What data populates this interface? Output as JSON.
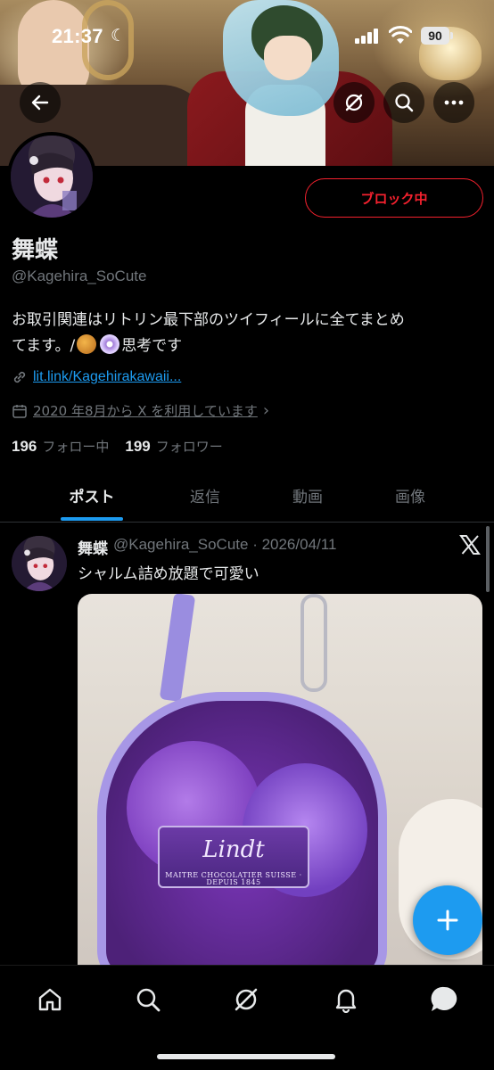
{
  "status_bar": {
    "time": "21:37",
    "battery": "90"
  },
  "header": {
    "back_icon": "arrow-left-icon",
    "grok_icon": "grok-icon",
    "search_icon": "search-icon",
    "more_icon": "more-icon"
  },
  "profile": {
    "display_name": "舞蝶",
    "handle": "@Kagehira_SoCute",
    "block_button_label": "ブロック中",
    "bio_line1": "お取引関連はリトリン最下部のツイフィールに全てまとめ",
    "bio_line2_pre": "てます。/",
    "bio_line2_post": "思考です",
    "link": "lit.link/Kagehirakawaii...",
    "joined": "2020 年8月から X を利用しています",
    "following_count": "196",
    "following_label": "フォロー中",
    "followers_count": "199",
    "followers_label": "フォロワー"
  },
  "tabs": [
    {
      "label": "ポスト",
      "active": true
    },
    {
      "label": "返信",
      "active": false
    },
    {
      "label": "動画",
      "active": false
    },
    {
      "label": "画像",
      "active": false
    }
  ],
  "post": {
    "name": "舞蝶",
    "meta": "@Kagehira_SoCute · 2026/04/11",
    "text": "シャルム詰め放題で可愛い",
    "image_label_brand": "Lindt",
    "image_label_sub": "MAITRE CHOCOLATIER SUISSE · DEPUIS 1845"
  },
  "colors": {
    "accent": "#1d9bf0",
    "block_red": "#f4212e",
    "muted": "#71767b",
    "text": "#e7e9ea"
  },
  "bottom_nav": [
    "home-icon",
    "search-icon",
    "grok-icon",
    "notifications-icon",
    "messages-icon"
  ]
}
